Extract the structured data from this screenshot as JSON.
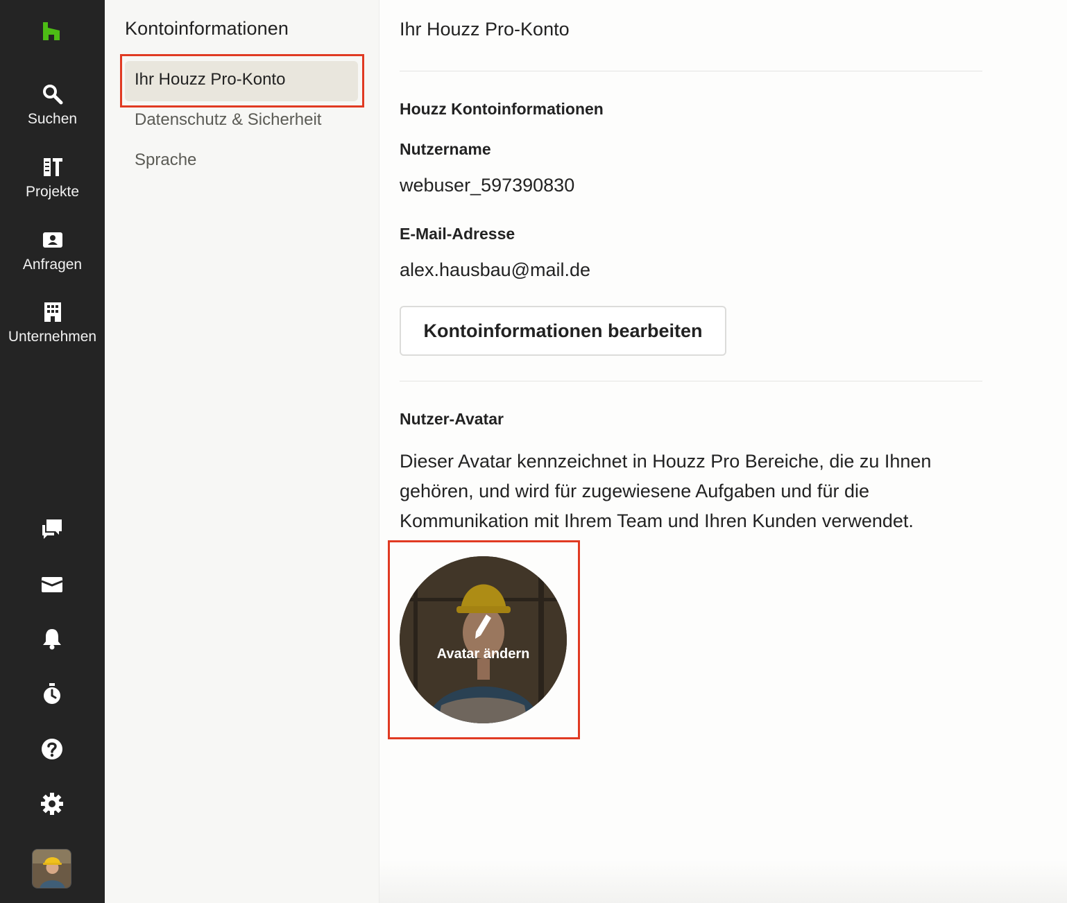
{
  "rail": {
    "logo": "houzz-logo-icon",
    "nav": [
      {
        "label": "Suchen",
        "icon": "search-icon"
      },
      {
        "label": "Projekte",
        "icon": "projects-icon"
      },
      {
        "label": "Anfragen",
        "icon": "inquiries-icon"
      },
      {
        "label": "Unternehmen",
        "icon": "company-icon"
      }
    ],
    "tools": [
      "chat-icon",
      "inbox-icon",
      "bell-icon",
      "timer-icon",
      "help-icon",
      "gear-icon"
    ],
    "accent": "#4dbc15"
  },
  "subnav": {
    "title": "Kontoinformationen",
    "items": [
      {
        "label": "Ihr Houzz Pro-Konto",
        "active": true
      },
      {
        "label": "Datenschutz & Sicherheit",
        "active": false
      },
      {
        "label": "Sprache",
        "active": false
      }
    ]
  },
  "main": {
    "title": "Ihr Houzz Pro-Konto",
    "account_section": "Houzz Kontoinformationen",
    "username_label": "Nutzername",
    "username_value": "webuser_597390830",
    "email_label": "E-Mail-Adresse",
    "email_value": "alex.hausbau@mail.de",
    "edit_button": "Kontoinformationen bearbeiten",
    "avatar_section": "Nutzer-Avatar",
    "avatar_description": "Dieser Avatar kennzeichnet in Houzz Pro Bereiche, die zu Ihnen gehören, und wird für zugewiesene Aufgaben und für die Kommunikation mit Ihrem Team und Ihren Kunden verwendet.",
    "avatar_action": "Avatar ändern"
  },
  "colors": {
    "rail_bg": "#242424",
    "subnav_bg": "#f7f7f5",
    "active_item_bg": "#e9e6dd",
    "highlight": "#e03a22"
  }
}
